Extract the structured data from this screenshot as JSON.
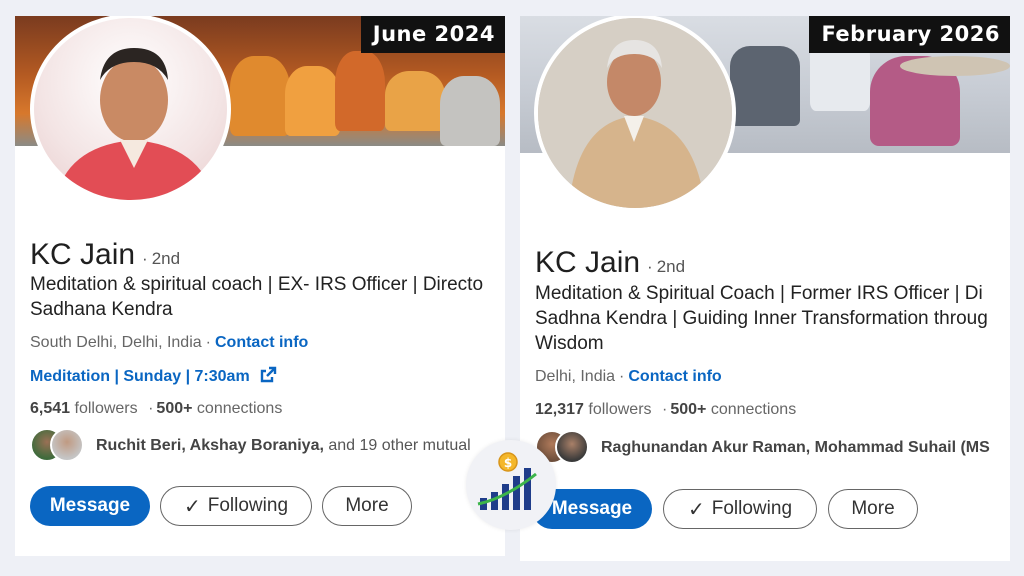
{
  "left": {
    "badge": "June 2024",
    "name": "KC Jain",
    "degree": "2nd",
    "headline_line1": "Meditation & spiritual coach | EX- IRS Officer | Directo",
    "headline_line2": "Sadhana Kendra",
    "location": "South Delhi, Delhi, India",
    "contact_label": "Contact info",
    "website_label": "Meditation | Sunday | 7:30am",
    "followers_count": "6,541",
    "followers_label": "followers",
    "connections_count": "500+",
    "connections_label": "connections",
    "mutual_names": "Ruchit Beri, Akshay Boraniya,",
    "mutual_rest": "and 19 other mutual",
    "message_label": "Message",
    "following_label": "Following",
    "more_label": "More"
  },
  "right": {
    "badge": "February 2026",
    "name": "KC Jain",
    "degree": "2nd",
    "headline_line1": "Meditation & Spiritual Coach | Former IRS Officer | Di",
    "headline_line2": "Sadhna Kendra | Guiding Inner Transformation throug",
    "headline_line3": "Wisdom",
    "location": "Delhi, India",
    "contact_label": "Contact info",
    "followers_count": "12,317",
    "followers_label": "followers",
    "connections_count": "500+",
    "connections_label": "connections",
    "mutual_names": "Raghunandan Akur Raman, Mohammad Suhail (MS",
    "message_label": "Message",
    "following_label": "Following",
    "more_label": "More"
  },
  "logo_icon": "growth-chart-coin-icon",
  "colors": {
    "primary": "#0a66c2",
    "badge_bg": "#111111",
    "page_bg": "#eef0f6"
  }
}
